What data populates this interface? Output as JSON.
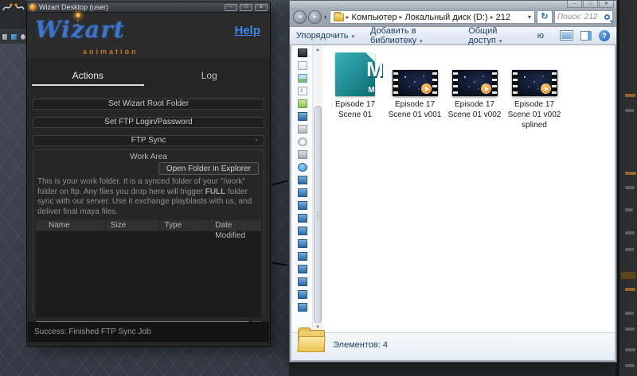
{
  "wizart": {
    "title": "Wizart Desktop (user)",
    "window_controls": {
      "minimize": "–",
      "maximize": "□",
      "close": "x"
    },
    "logo": {
      "name": "Wizart",
      "tagline": "animation"
    },
    "help_link": "Help",
    "tabs": {
      "actions": "Actions",
      "log": "Log"
    },
    "actions": {
      "set_root": "Set Wizart Root Folder",
      "set_ftp": "Set FTP Login/Password",
      "ftp_sync": "FTP Sync",
      "ftp_sync_indicator": "-"
    },
    "work_area": {
      "title": "Work Area",
      "open_folder_button": "Open Folder in Explorer",
      "description_before": "This is your work folder. It is a synced folder of your \"/work\" folder on ftp. Any files you drop here will trigger ",
      "description_bold": "FULL",
      "description_after": " folder sync with our server. Use it exchange playblasts with us, and deliver final maya files.",
      "table": {
        "headers": [
          "Name",
          "Size",
          "Type",
          "Date Modified"
        ]
      }
    },
    "status_bar": "Success: Finished FTP Sync Job"
  },
  "explorer": {
    "window_controls": {
      "minimize": "–",
      "maximize": "□",
      "close": "✕"
    },
    "address": {
      "crumbs": [
        "Компьютер",
        "Локальный диск (D:)",
        "212"
      ]
    },
    "search": {
      "placeholder": "Поиск: 212"
    },
    "toolbar": {
      "organize": "Упорядочить",
      "add_to_library": "Добавить в библиотеку",
      "share": "Общий доступ",
      "truncated_item": "ю"
    },
    "nav_icons": [
      "videos",
      "document",
      "image",
      "music",
      "homegroup",
      "computer",
      "disk",
      "cd",
      "printer",
      "network",
      "pc",
      "pc",
      "pc",
      "pc",
      "pc",
      "pc",
      "pc",
      "pc",
      "pc",
      "pc",
      "pc"
    ],
    "files": [
      {
        "name": "Episode 17 Scene 01",
        "kind": "maya",
        "monogram": "M",
        "badge": "MB"
      },
      {
        "name": "Episode 17 Scene 01 v001",
        "kind": "video"
      },
      {
        "name": "Episode 17 Scene 01 v002",
        "kind": "video"
      },
      {
        "name": "Episode 17 Scene 01 v002 splined",
        "kind": "video"
      }
    ],
    "details": {
      "items_count_label": "Элементов: 4"
    }
  },
  "icons": {
    "back": "◄",
    "forward": "►",
    "nav_dropdown": "▾",
    "crumb_sep": "▸",
    "address_dropdown": "▾",
    "refresh": "↻",
    "toolbar_dropdown": "▾",
    "help": "?",
    "scroll_up": "▲",
    "scroll_down": "▼"
  },
  "colors": {
    "accent_blue": "#3f86e8",
    "logo_blue": "#3e74c9",
    "logo_orange": "#c07c22",
    "maya_teal": "#127f82",
    "play_orange": "#e6932e",
    "folder_yellow": "#e8c35a",
    "explorer_text": "#1e3c5c",
    "viewport_gray": "#3a414a"
  }
}
